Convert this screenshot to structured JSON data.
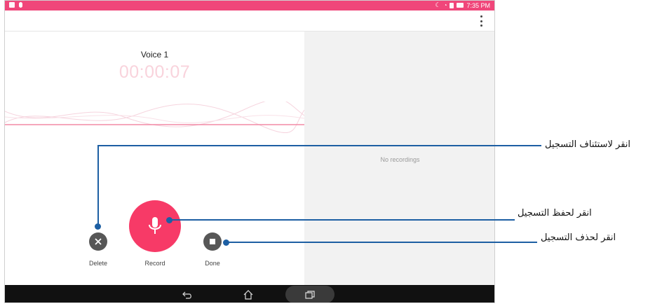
{
  "status_bar": {
    "time": "7:35 PM"
  },
  "recorder": {
    "title": "Voice 1",
    "timer": "00:00:07",
    "delete_label": "Delete",
    "record_label": "Record",
    "done_label": "Done"
  },
  "recordings": {
    "empty_text": "No recordings"
  },
  "annotations": {
    "resume": "انقر لاستئناف التسجيل",
    "save": "انقر لحفظ التسجيل",
    "delete": "انقر لحذف التسجيل"
  },
  "colors": {
    "accent": "#f73a67",
    "status_bar": "#f0467a",
    "callout": "#1d5fa3"
  },
  "icons": [
    "menu-dots-icon",
    "close-icon",
    "microphone-icon",
    "stop-icon",
    "back-icon",
    "home-icon",
    "recents-icon"
  ]
}
